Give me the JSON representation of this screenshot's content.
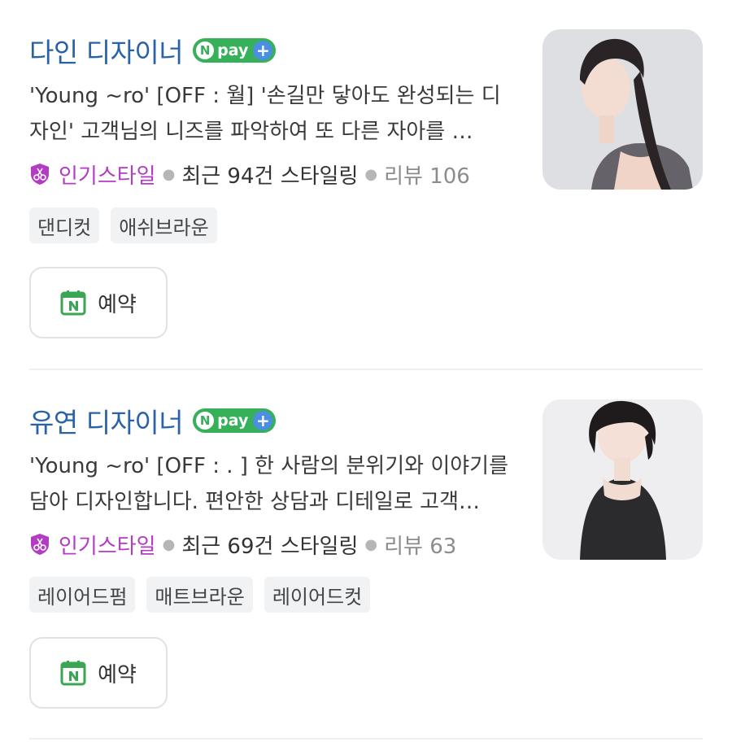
{
  "designers": [
    {
      "name": "다인 디자이너",
      "npay": {
        "n": "N",
        "pay": "pay",
        "plus": "+"
      },
      "desc_line1": "'Young ~ro' [OFF : 월] '손길만 닿아도 완성되는 디",
      "desc_line2": "자인' 고객님의 니즈를 파악하여 또 다른 자아를 …",
      "popular": "인기스타일",
      "recent": "최근 94건 스타일링",
      "review": "리뷰 106",
      "tags": [
        "댄디컷",
        "애쉬브라운"
      ],
      "book_label": "예약"
    },
    {
      "name": "유연 디자이너",
      "npay": {
        "n": "N",
        "pay": "pay",
        "plus": "+"
      },
      "desc_line1": "'Young ~ro' [OFF : . ] 한 사람의 분위기와 이야기를",
      "desc_line2": "담아 디자인합니다. 편안한 상담과 디테일로 고객…",
      "popular": "인기스타일",
      "recent": "최근 69건 스타일링",
      "review": "리뷰 63",
      "tags": [
        "레이어드펌",
        "매트브라운",
        "레이어드컷"
      ],
      "book_label": "예약"
    }
  ],
  "colors": {
    "name": "#2a62a8",
    "popular": "#b23cc2",
    "npay": "#36b15a",
    "calendar": "#3aa655"
  },
  "icons": [
    "scissors-badge-icon",
    "calendar-icon",
    "npay-logo"
  ]
}
